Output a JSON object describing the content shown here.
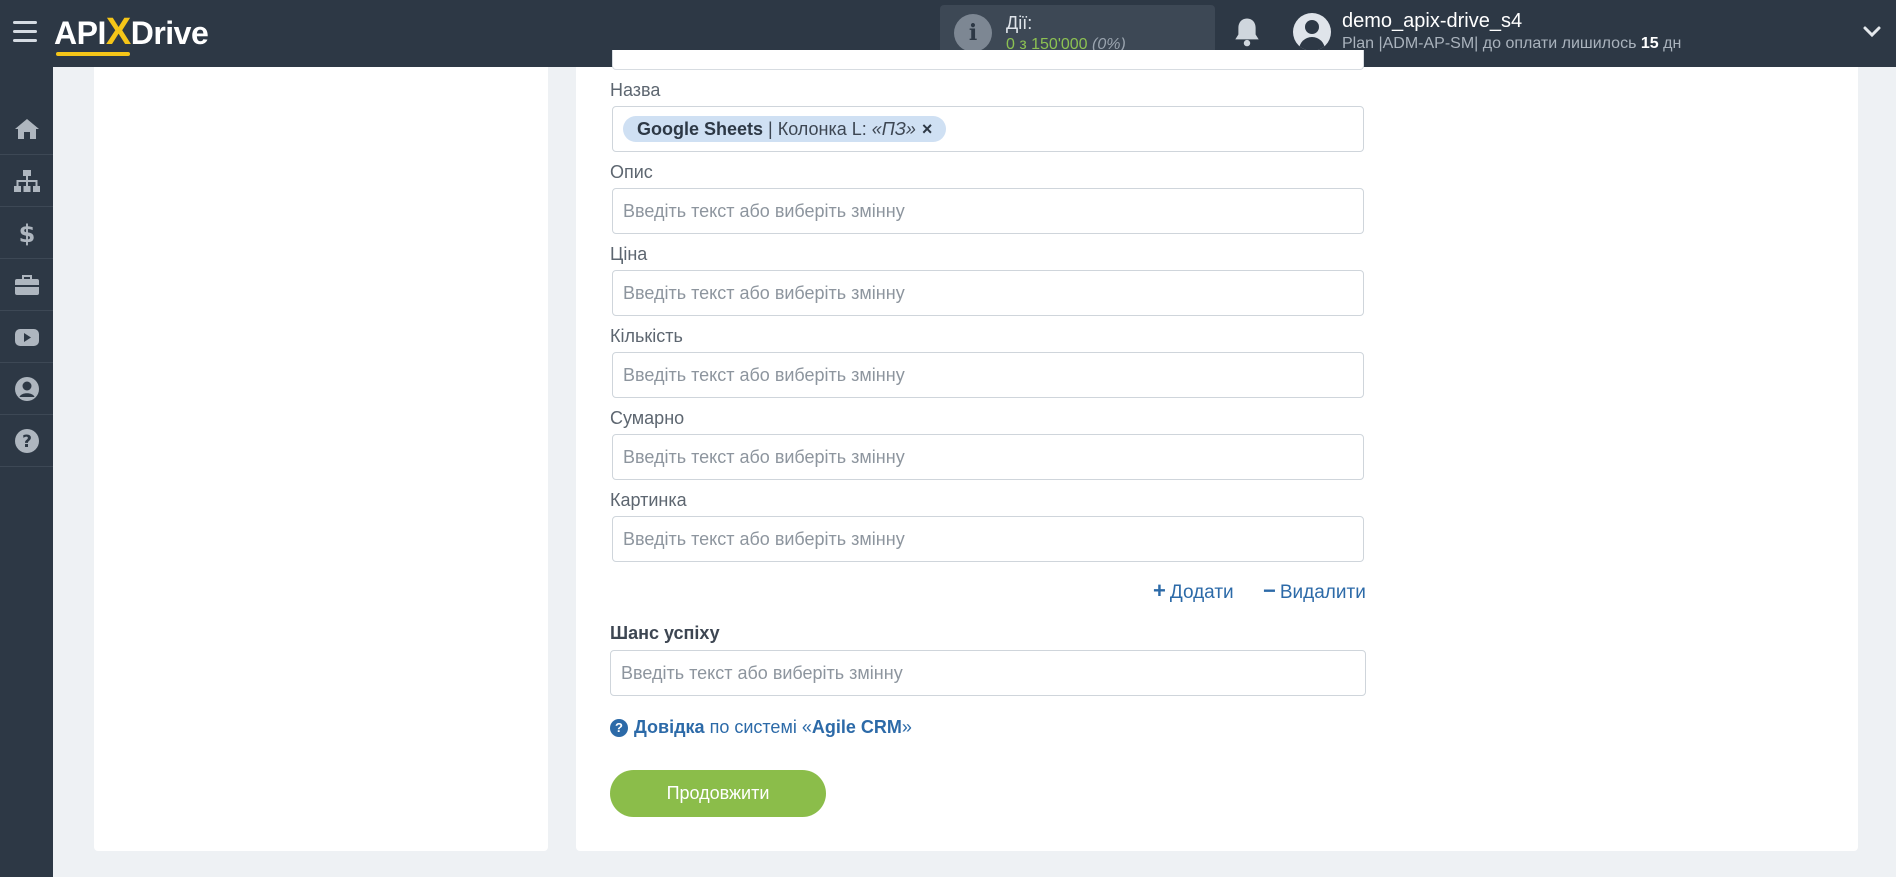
{
  "header": {
    "logo_text_1": "API",
    "logo_text_x": "X",
    "logo_text_2": "Drive",
    "actions_label": "Дії:",
    "actions_value": "0 з 150'000",
    "actions_percent": "(0%)",
    "username": "demo_apix-drive_s4",
    "plan_prefix": "Plan |ADM-AP-SM| до оплати лишилось",
    "plan_days": "15",
    "plan_suffix": "дн"
  },
  "sidebar": {
    "items": [
      {
        "icon": "home-icon"
      },
      {
        "icon": "sitemap-icon"
      },
      {
        "icon": "dollar-icon"
      },
      {
        "icon": "briefcase-icon"
      },
      {
        "icon": "youtube-icon"
      },
      {
        "icon": "user-circle-icon"
      },
      {
        "icon": "question-circle-icon"
      }
    ]
  },
  "form": {
    "name": {
      "label": "Назва",
      "tag_source": "Google Sheets",
      "tag_separator": " | Колонка L: ",
      "tag_value": "«ПЗ»",
      "tag_remove": "×"
    },
    "placeholder": "Введіть текст або виберіть змінну",
    "description_label": "Опис",
    "price_label": "Ціна",
    "quantity_label": "Кількість",
    "total_label": "Сумарно",
    "image_label": "Картинка",
    "add_label": "Додати",
    "remove_label": "Видалити",
    "success_chance_label": "Шанс успіху"
  },
  "help": {
    "link_label": "Довідка",
    "middle_text": "по системі «",
    "system_name": "Agile CRM",
    "end_text": "»"
  },
  "continue_label": "Продовжити",
  "colors": {
    "header_bg": "#2d3845",
    "accent_green": "#8bbd4a",
    "link_blue": "#2c6aa8",
    "tag_bg": "#cfe0f3"
  }
}
